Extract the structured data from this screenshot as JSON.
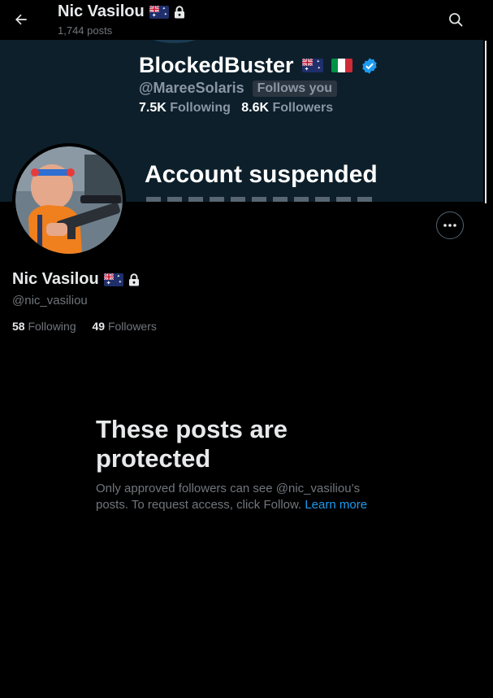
{
  "header": {
    "title": "Nic Vasilou",
    "posts": "1,744 posts"
  },
  "banner": {
    "name": "BlockedBuster",
    "handle": "@MareeSolaris",
    "follows_you": "Follows you",
    "following_count": "7.5K",
    "following_label": "Following",
    "followers_count": "8.6K",
    "followers_label": "Followers",
    "suspended": "Account suspended"
  },
  "profile": {
    "name": "Nic Vasilou",
    "handle": "@nic_vasiliou",
    "following_count": "58",
    "following_label": "Following",
    "followers_count": "49",
    "followers_label": "Followers"
  },
  "protected": {
    "title": "These posts are protected",
    "body": "Only approved followers can see @nic_vasiliou’s posts. To request access, click Follow.",
    "link": "Learn more"
  },
  "colors": {
    "link": "#1d9bf0",
    "muted": "#71767b",
    "text": "#e7e9ea",
    "banner_bg": "#0d1f2a"
  },
  "icons": [
    "back-arrow-icon",
    "search-icon",
    "australia-flag-icon",
    "lock-icon",
    "italy-flag-icon",
    "verified-badge-icon",
    "more-icon"
  ]
}
